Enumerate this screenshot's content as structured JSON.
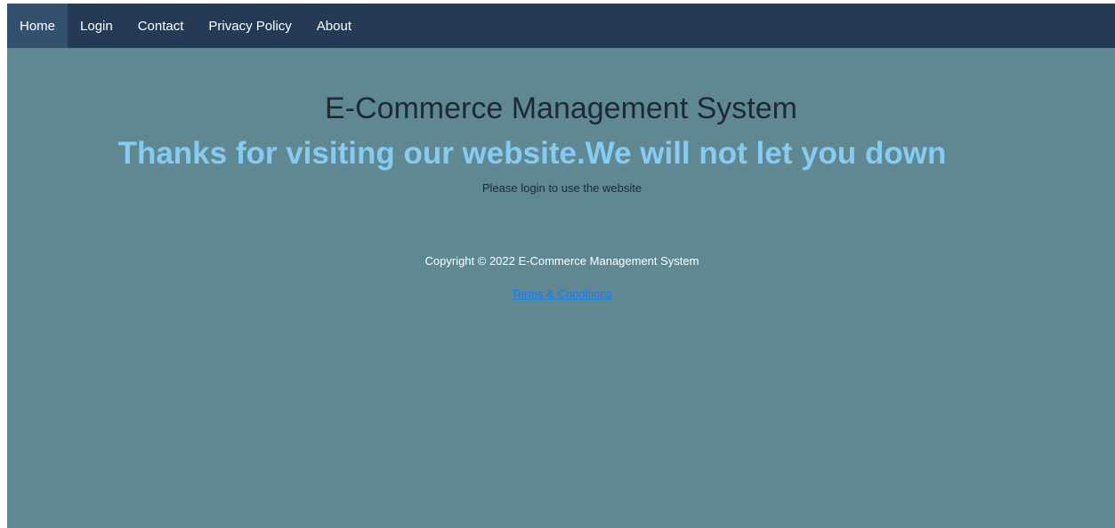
{
  "nav": {
    "items": [
      {
        "label": "Home"
      },
      {
        "label": "Login"
      },
      {
        "label": "Contact"
      },
      {
        "label": "Privacy Policy"
      },
      {
        "label": "About"
      }
    ],
    "active": "Home"
  },
  "main": {
    "title": "E-Commerce Management System",
    "subtitle": "Thanks for visiting our website.We will not let you down",
    "login_note": "Please login to use the website"
  },
  "footer": {
    "copyright": "Copyright © 2022 E-Commerce Management System",
    "terms_link": "Terms & Conditions"
  },
  "colors": {
    "navbar": "#253a55",
    "active_nav": "#34506f",
    "page_background": "#5f8893",
    "subtitle": "#88cbf0",
    "link": "#1b7cf2"
  }
}
